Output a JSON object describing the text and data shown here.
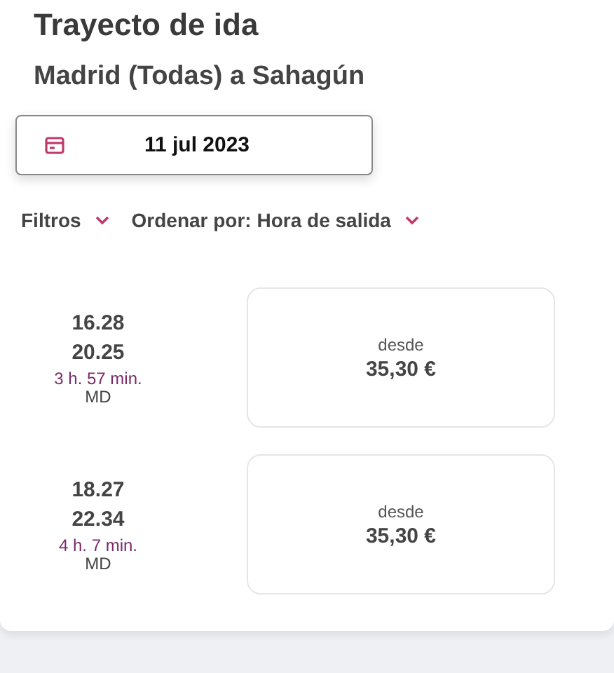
{
  "header": {
    "title": "Trayecto de ida",
    "route": "Madrid (Todas) a Sahagún"
  },
  "date_button": {
    "label": "11 jul 2023"
  },
  "filters": [
    {
      "label": "Filtros"
    },
    {
      "label": "Ordenar por: Hora de salida"
    }
  ],
  "trips": [
    {
      "departure": "16.28",
      "arrival": "20.25",
      "duration": "3 h. 57 min.",
      "train_type": "MD",
      "price_prefix": "desde",
      "price": "35,30 €"
    },
    {
      "departure": "18.27",
      "arrival": "22.34",
      "duration": "4 h. 7 min.",
      "train_type": "MD",
      "price_prefix": "desde",
      "price": "35,30 €"
    }
  ]
}
